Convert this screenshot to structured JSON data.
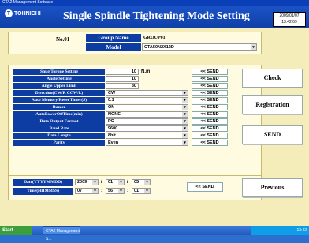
{
  "window": {
    "title": "CTA2 Management Software"
  },
  "header": {
    "logo_text": "TOHNICHI",
    "title": "Single Spindle Tightening Mode Setting",
    "date": "2009/01/07",
    "time": "13:42:09"
  },
  "group": {
    "no": "No.01",
    "group_name_label": "Group Name",
    "group_name_value": "GROUP01",
    "model_label": "Model",
    "model_value": "CTA50N2X12D"
  },
  "settings": {
    "send_label": "<< SEND",
    "snug_torque": {
      "label": "Snug Torque Setting",
      "value": "10",
      "unit": "N.m"
    },
    "angle": {
      "label": "Angle Setting",
      "value": "10"
    },
    "angle_upper": {
      "label": "Angle Upper Limit",
      "value": "30"
    },
    "direction": {
      "label": "Direction(CW/R CCW/L)",
      "value": "CW"
    },
    "auto_memory": {
      "label": "Auto Memory/Reset Timer(S)",
      "value": "0.1"
    },
    "buzzer": {
      "label": "Buzzer",
      "value": "ON"
    },
    "auto_power_off": {
      "label": "AutoPowerOffTime(min)",
      "value": "NONE"
    },
    "data_output": {
      "label": "Data Output Format",
      "value": "PC"
    },
    "baud_rate": {
      "label": "Baud Rate",
      "value": "9600"
    },
    "data_length": {
      "label": "Data Length",
      "value": "8bit"
    },
    "parity": {
      "label": "Parity",
      "value": "Even"
    }
  },
  "datetime": {
    "date_label": "Date(YYYYMMDD)",
    "time_label": "Time(HHMMSS)",
    "year": "2009",
    "month": "01",
    "day": "05",
    "hour": "07",
    "minute": "56",
    "second": "01",
    "send_label": "<< SEND"
  },
  "buttons": {
    "check": "Check",
    "registration": "Registration",
    "send": "SEND",
    "previous": "Previous"
  },
  "taskbar": {
    "start": "Start",
    "task": "CTA2 Management S...",
    "clock": "13:42"
  },
  "colors": {
    "label_bg": "#0d3ca3",
    "panel_bg": "#fffbe0",
    "window_bg": "#f4edb9",
    "header_bg": "#1b54c8"
  }
}
